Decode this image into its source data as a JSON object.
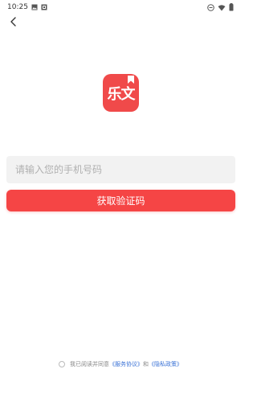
{
  "status_bar": {
    "time": "10:25",
    "icons_left": [
      "image-icon",
      "notification-icon"
    ],
    "icons_right": [
      "minus-circle-icon",
      "wifi-icon",
      "battery-icon"
    ]
  },
  "header": {
    "back_icon": "chevron-left-icon"
  },
  "logo": {
    "text": "乐文",
    "color": "#f04a4a"
  },
  "phone": {
    "placeholder": "请输入您的手机号码",
    "value": ""
  },
  "submit": {
    "label": "获取验证码",
    "color": "#f54545"
  },
  "agreement": {
    "prefix": "我已阅读并同意",
    "service_link": "《服务协议》",
    "conjunction": "和",
    "privacy_link": "《隐私政策》",
    "link_color": "#3a72d6"
  }
}
